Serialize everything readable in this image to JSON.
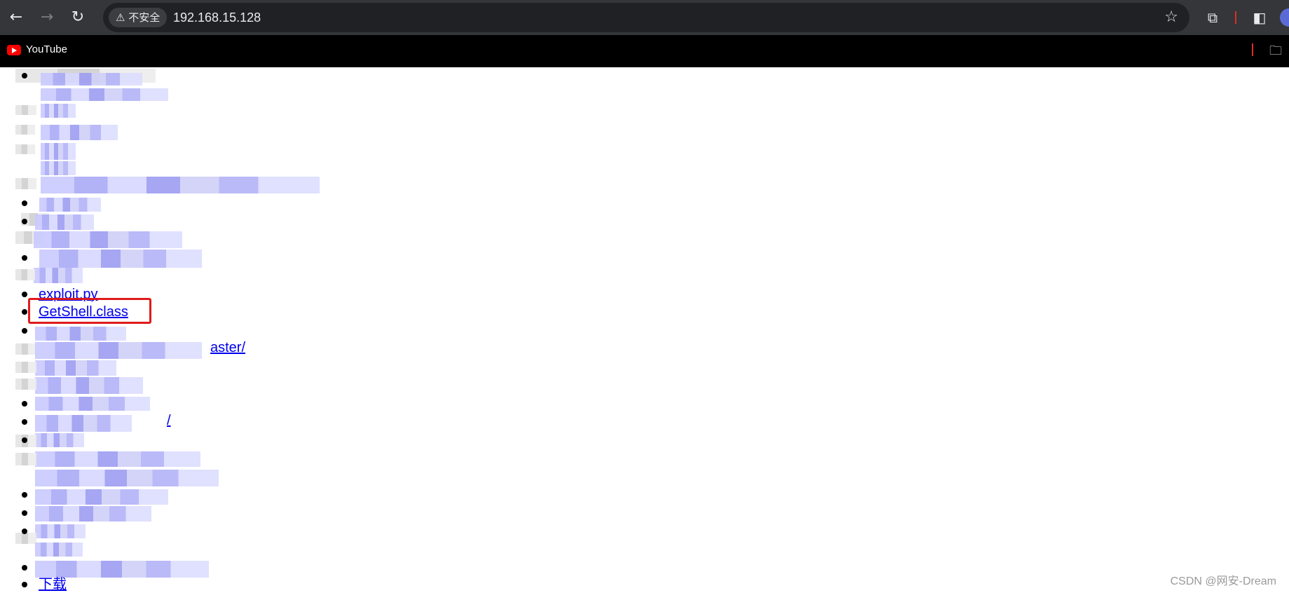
{
  "browser": {
    "nav": {
      "back_icon": "←",
      "forward_icon": "→",
      "reload_icon": "↻"
    },
    "security_chip": "⚠ 不安全",
    "url": "192.168.15.128",
    "star_icon": "☆",
    "extensions_icon": "⧉",
    "sidepanel_icon": "◧"
  },
  "bookmarks": [
    {
      "label": "YouTube",
      "icon": "youtube-icon"
    }
  ],
  "listing": [
    {
      "text": "exploit.py"
    },
    {
      "text": "GetShell.class"
    },
    {
      "text": "aster/"
    },
    {
      "text": "/"
    },
    {
      "text": "下载"
    }
  ],
  "watermark": "CSDN @网安-Dream"
}
